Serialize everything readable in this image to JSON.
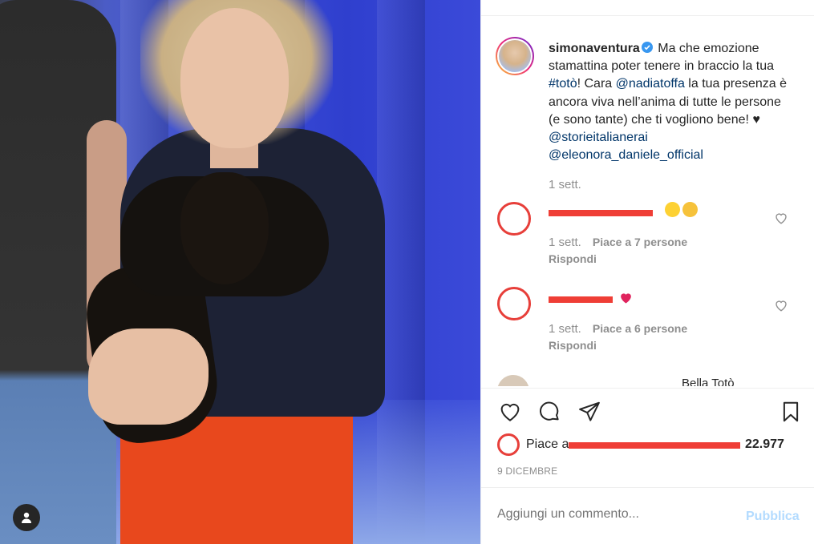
{
  "post": {
    "username": "simonaventura",
    "caption_pre": " Ma che emozione stamattina poter tenere in braccio la tua ",
    "hashtag": "#totò",
    "caption_mid": "! Cara ",
    "mention1": "@nadiatoffa",
    "caption_post": " la tua presenza è ancora viva nell’anima di tutte le persone (e sono tante) che ti vogliono bene! ♥ ",
    "mention2": "@storieitalianerai",
    "mention3": "@eleonora_daniele_official",
    "time": "1 sett."
  },
  "comments": [
    {
      "time": "1 sett.",
      "likes": "Piace a 7 persone",
      "reply": "Rispondi",
      "emojis": [
        "heart-eyes-icon",
        "sad-face-icon"
      ]
    },
    {
      "time": "1 sett.",
      "likes": "Piace a 6 persone",
      "reply": "Rispondi",
      "emojis": [
        "red-heart-icon"
      ]
    }
  ],
  "partial_comment": {
    "text": "Bella Totò"
  },
  "footer": {
    "likes_prefix": "Piace a",
    "likes_count": "22.977",
    "date": "9 DICEMBRE",
    "add_comment_placeholder": "Aggiungi un commento...",
    "publish": "Pubblica"
  },
  "colors": {
    "link": "#003569",
    "redaction": "#ef3e36",
    "publish_disabled": "#b3dbff"
  }
}
